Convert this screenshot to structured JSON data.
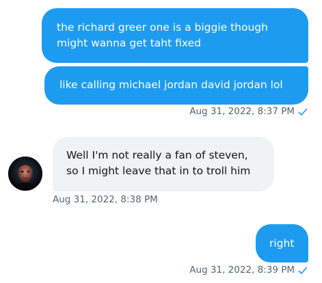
{
  "messages": [
    {
      "direction": "outgoing",
      "lines": [
        "the richard greer one is a biggie though",
        "might wanna get taht fixed"
      ]
    },
    {
      "direction": "outgoing",
      "lines": [
        "like calling michael jordan david jordan lol"
      ],
      "timestamp": "Aug 31, 2022, 8:37 PM",
      "status_icon": "checkmark-icon"
    },
    {
      "direction": "incoming",
      "lines": [
        "Well I'm not really a fan of steven,",
        "so I might leave that in to troll him"
      ],
      "timestamp": "Aug 31, 2022, 8:38 PM",
      "avatar_icon": "user-avatar"
    },
    {
      "direction": "outgoing",
      "lines": [
        "right"
      ],
      "timestamp": "Aug 31, 2022, 8:39 PM",
      "status_icon": "checkmark-icon"
    }
  ],
  "colors": {
    "outgoing_bubble": "#1d9bf0",
    "incoming_bubble": "#eff3f4",
    "incoming_text": "#0f1419",
    "meta_text": "#536471",
    "check": "#1d9bf0"
  }
}
